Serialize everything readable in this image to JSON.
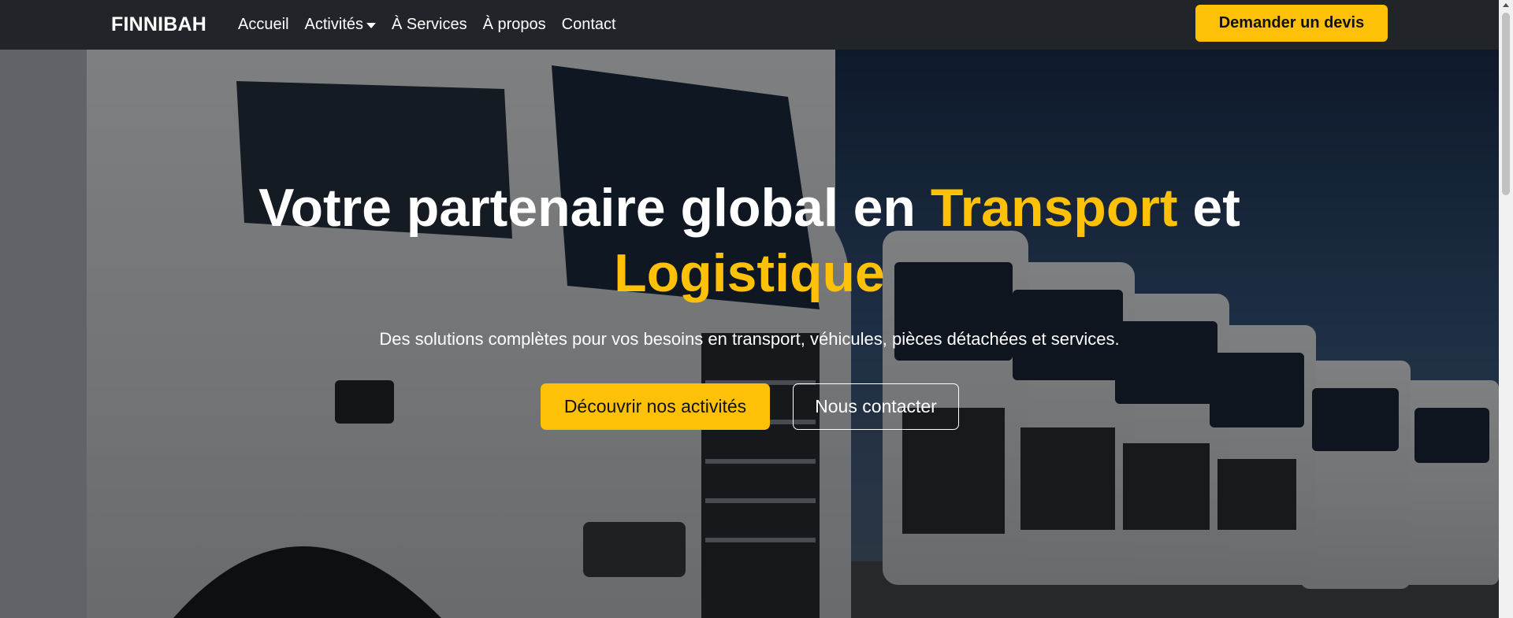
{
  "navbar": {
    "brand": "FINNIBAH",
    "links": [
      {
        "label": "Accueil"
      },
      {
        "label": "Activités",
        "dropdown": true
      },
      {
        "label": "À Services"
      },
      {
        "label": "À propos"
      },
      {
        "label": "Contact"
      }
    ],
    "cta_label": "Demander un devis"
  },
  "hero": {
    "title_part1": "Votre partenaire global en ",
    "title_highlight1": "Transport",
    "title_part2": " et",
    "title_highlight2": "Logistique",
    "subtitle": "Des solutions complètes pour vos besoins en transport, véhicules, pièces détachées et services.",
    "primary_button": "Découvrir nos activités",
    "secondary_button": "Nous contacter",
    "background_image": "fleet of white trucks parked in a row under a blue sky"
  },
  "colors": {
    "navbar_bg": "#212529",
    "accent": "#ffc107",
    "text_light": "#ffffff"
  }
}
